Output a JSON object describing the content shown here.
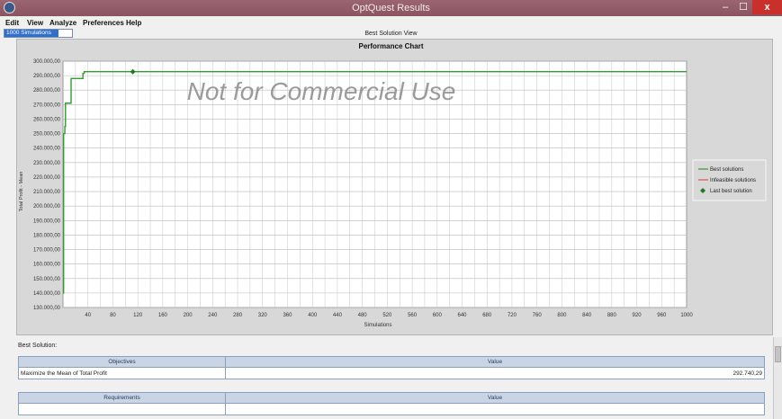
{
  "window": {
    "title": "OptQuest Results",
    "minimize": "–",
    "maximize": "☐",
    "close": "x"
  },
  "menu": [
    {
      "label": "Edit"
    },
    {
      "label": "View"
    },
    {
      "label": "Analyze"
    },
    {
      "label": "Preferences"
    },
    {
      "label": "Help"
    }
  ],
  "simulations_selector": "1000 Simulations",
  "view_title": "Best Solution View",
  "watermark": "Not for Commercial Use",
  "chart_data": {
    "type": "line",
    "title": "Performance Chart",
    "xlabel": "Simulations",
    "ylabel": "Total Profit - Mean",
    "xlim": [
      0,
      1000
    ],
    "ylim": [
      130000,
      300000
    ],
    "x_ticks": [
      40,
      80,
      120,
      160,
      200,
      240,
      280,
      320,
      360,
      400,
      440,
      480,
      520,
      560,
      600,
      640,
      680,
      720,
      760,
      800,
      840,
      880,
      920,
      960,
      1000
    ],
    "y_ticks": [
      130000,
      140000,
      150000,
      160000,
      170000,
      180000,
      190000,
      200000,
      210000,
      220000,
      230000,
      240000,
      250000,
      260000,
      270000,
      280000,
      290000,
      300000
    ],
    "y_tick_labels": [
      "130.000,00",
      "140.000,00",
      "150.000,00",
      "160.000,00",
      "170.000,00",
      "180.000,00",
      "190.000,00",
      "200.000,00",
      "210.000,00",
      "220.000,00",
      "230.000,00",
      "240.000,00",
      "250.000,00",
      "260.000,00",
      "270.000,00",
      "280.000,00",
      "290.000,00",
      "300.000,00"
    ],
    "grid": true,
    "legend_position": "right",
    "legend": [
      {
        "label": "Best solutions",
        "color": "#2e9e2e",
        "marker": "line"
      },
      {
        "label": "Infeasible solutions",
        "color": "#e05050",
        "marker": "line"
      },
      {
        "label": "Last best solution",
        "color": "#1f7a1f",
        "marker": "diamond"
      }
    ],
    "series": [
      {
        "name": "Best solutions",
        "color": "#2e9e2e",
        "points": [
          [
            0,
            140000
          ],
          [
            1,
            250000
          ],
          [
            3,
            255000
          ],
          [
            4,
            271000
          ],
          [
            12,
            271000
          ],
          [
            13,
            288000
          ],
          [
            30,
            288000
          ],
          [
            32,
            291500
          ],
          [
            34,
            292740
          ],
          [
            1000,
            292740
          ]
        ]
      }
    ],
    "last_best": {
      "x": 112,
      "y": 292740
    }
  },
  "best_solution_label": "Best Solution:",
  "objectives_table": {
    "headers": [
      "Objectives",
      "Value"
    ],
    "rows": [
      [
        "Maximize the Mean of Total Profit",
        "292.740,29"
      ]
    ]
  },
  "requirements_table": {
    "headers": [
      "Requirements",
      "Value"
    ]
  }
}
